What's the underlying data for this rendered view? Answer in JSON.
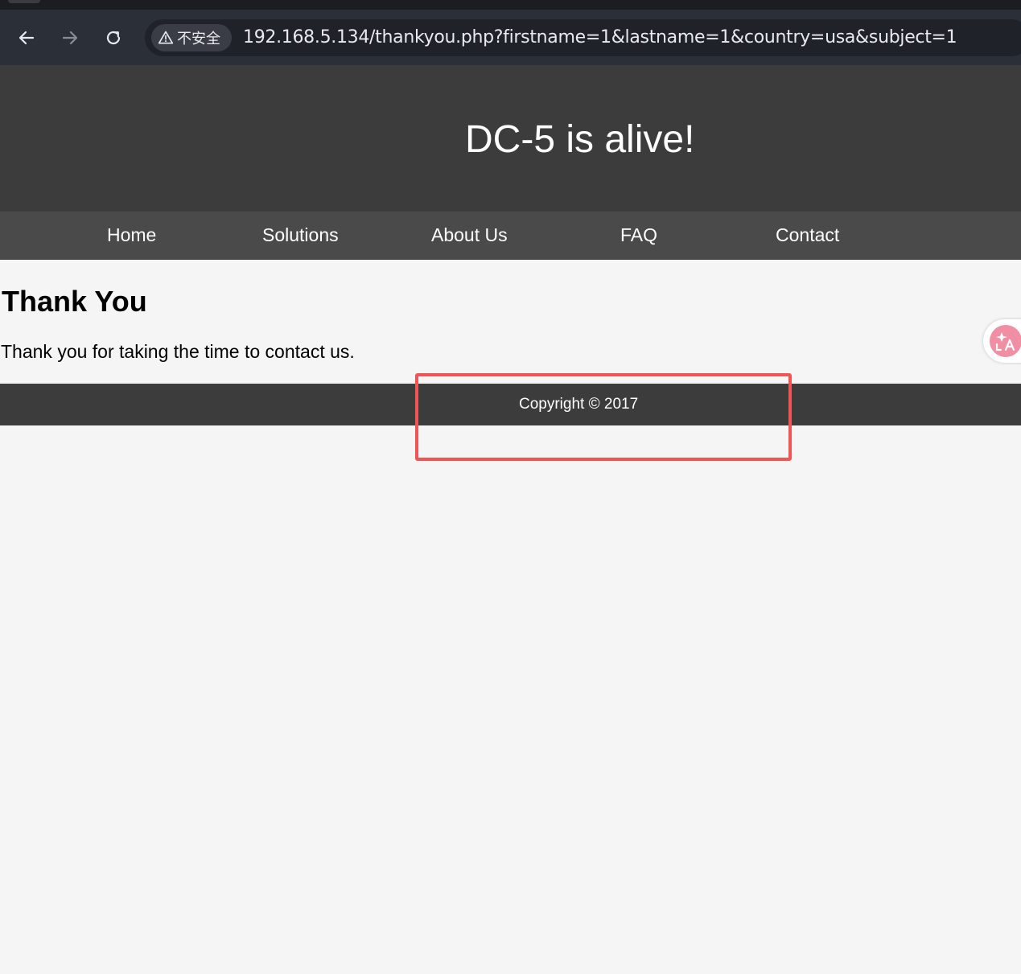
{
  "browser": {
    "security_label": "不安全",
    "url": "192.168.5.134/thankyou.php?firstname=1&lastname=1&country=usa&subject=1",
    "icons": [
      "back-arrow-icon",
      "forward-arrow-icon",
      "reload-icon",
      "warning-icon"
    ]
  },
  "site": {
    "title": "DC-5 is alive!",
    "nav": [
      {
        "label": "Home"
      },
      {
        "label": "Solutions"
      },
      {
        "label": "About Us"
      },
      {
        "label": "FAQ"
      },
      {
        "label": "Contact"
      }
    ]
  },
  "content": {
    "heading": "Thank You",
    "message": "Thank you for taking the time to contact us."
  },
  "footer": {
    "copyright": "Copyright © 2017"
  },
  "colors": {
    "header_bg": "#3c3c3c",
    "nav_bg": "#4a4a4a",
    "page_bg": "#f5f5f5",
    "highlight": "#f05454",
    "translate_accent": "#f08ea3"
  },
  "widgets": {
    "translate_icon": "translate-icon"
  }
}
